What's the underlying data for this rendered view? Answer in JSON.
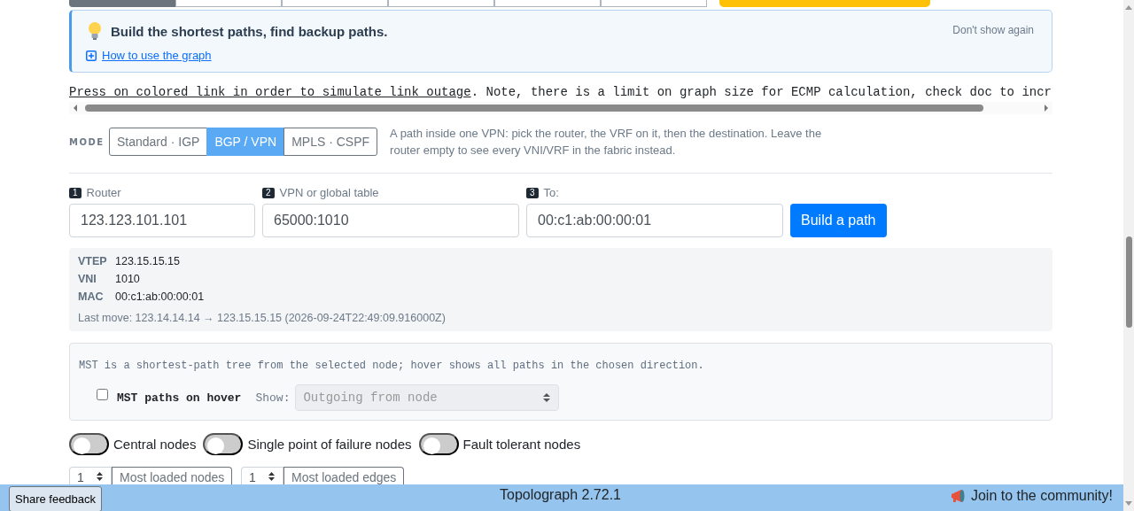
{
  "top_tabs": [
    {
      "selected": true
    },
    {
      "selected": false
    },
    {
      "selected": false
    },
    {
      "selected": false
    },
    {
      "selected": false
    },
    {
      "selected": false
    }
  ],
  "alert": {
    "title": "Build the shortest paths, find backup paths.",
    "link": "How to use the graph",
    "dismiss": "Don't show again"
  },
  "notice": {
    "link": "Press on colored link in order to simulate link outage",
    "text": ". Note, there is a limit on graph size for ECMP calculation, check doc to incr"
  },
  "mode": {
    "label": "MODE",
    "options": [
      {
        "label": "Standard · IGP",
        "selected": false
      },
      {
        "label": "BGP / VPN",
        "selected": true
      },
      {
        "label": "MPLS · CSPF",
        "selected": false
      }
    ],
    "hint": "A path inside one VPN: pick the router, the VRF on it, then the destination. Leave the router empty to see every VNI/VRF in the fabric instead."
  },
  "fields": [
    {
      "step": "1",
      "label": "Router",
      "value": "123.123.101.101"
    },
    {
      "step": "2",
      "label": "VPN or global table",
      "value": "65000:1010"
    },
    {
      "step": "3",
      "label": "To:",
      "value": "00:c1:ab:00:00:01"
    }
  ],
  "build_button": "Build a path",
  "info": {
    "rows": [
      {
        "key": "VTEP",
        "value": "123.15.15.15"
      },
      {
        "key": "VNI",
        "value": "1010"
      },
      {
        "key": "MAC",
        "value": "00:c1:ab:00:00:01"
      }
    ],
    "last_move": "Last move: 123.14.14.14 → 123.15.15.15 (2026-09-24T22:49:09.916000Z)"
  },
  "mst": {
    "description": "MST is a shortest-path tree from the selected node; hover shows all paths in the chosen direction.",
    "checkbox": {
      "label": "MST paths on hover",
      "checked": false
    },
    "show_label": "Show:",
    "select": {
      "value": "Outgoing from node",
      "disabled": true
    }
  },
  "toggles": [
    {
      "label": "Central nodes",
      "on": false
    },
    {
      "label": "Single point of failure nodes",
      "on": false
    },
    {
      "label": "Fault tolerant nodes",
      "on": false
    }
  ],
  "loaded": [
    {
      "value": "1",
      "placeholder": "Most loaded nodes"
    },
    {
      "value": "1",
      "placeholder": "Most loaded edges"
    }
  ],
  "footer": {
    "feedback": "Share feedback",
    "version": "Topolograph 2.72.1",
    "community": "Join to the community!"
  }
}
